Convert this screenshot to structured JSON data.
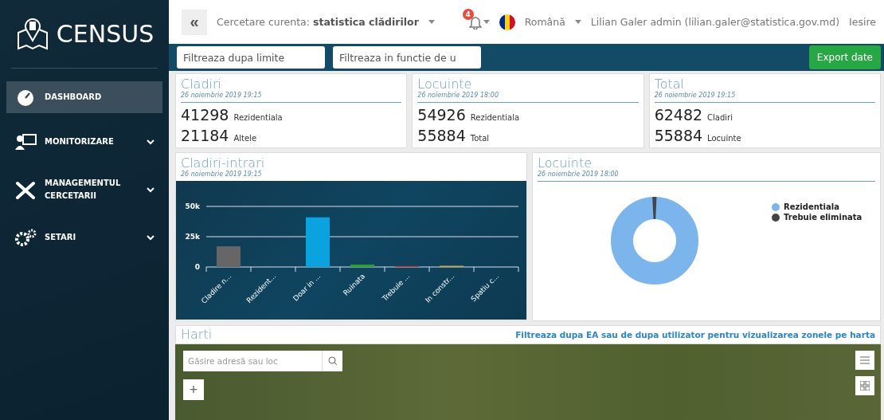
{
  "brand": {
    "name": "CENSUS"
  },
  "sidebar": {
    "items": [
      {
        "label": "DASHBOARD",
        "kind": "dashboard",
        "selected": true,
        "expandable": false
      },
      {
        "label": "MONITORIZARE",
        "kind": "monitor",
        "selected": false,
        "expandable": true
      },
      {
        "label": "MANAGEMENTUL CERCETARII",
        "kind": "tools",
        "selected": false,
        "expandable": true
      },
      {
        "label": "SETARI",
        "kind": "gears",
        "selected": false,
        "expandable": true
      }
    ]
  },
  "topbar": {
    "collapse": "«",
    "research_label": "Cercetare curenta:",
    "research_value": "statistica clădirilor",
    "notifications": "4",
    "language": "Română",
    "user": "Lilian Galer admin (lilian.galer@statistica.gov.md)",
    "logout": "Iesire"
  },
  "filters": {
    "fields": [
      {
        "placeholder": "Filtreaza dupa limite"
      },
      {
        "placeholder": "Filtreaza in functie de u"
      }
    ],
    "export": "Export date"
  },
  "summary_cards": [
    {
      "title": "Cladiri",
      "date": "26 noiembrie 2019 19:15",
      "rows": [
        {
          "value": "41298",
          "label": "Rezidentiala"
        },
        {
          "value": "21184",
          "label": "Altele"
        }
      ]
    },
    {
      "title": "Locuinte",
      "date": "26 noiembrie 2019 18:00",
      "rows": [
        {
          "value": "54926",
          "label": "Rezidentiala"
        },
        {
          "value": "55884",
          "label": "Total"
        }
      ]
    },
    {
      "title": "Total",
      "date": "26 noiembrie 2019 19:15",
      "rows": [
        {
          "value": "62482",
          "label": "Cladiri"
        },
        {
          "value": "55884",
          "label": "Locuinte"
        }
      ]
    }
  ],
  "bar_panel": {
    "title": "Cladiri-intrari",
    "date": "26 noiembrie 2019 19:15",
    "chart_data": {
      "type": "bar",
      "categories": [
        "Cladire n...",
        "Rezident...",
        "Doar in ...",
        "Ruinata",
        "Trebuie ...",
        "In constr...",
        "Spatiu c..."
      ],
      "ylim": [
        0,
        50000
      ],
      "series": [
        {
          "color": "#666666",
          "values": [
            17000,
            null,
            null,
            null,
            null,
            null,
            null
          ]
        },
        {
          "color": "#0aa3e0",
          "values": [
            null,
            null,
            41000,
            null,
            null,
            null,
            null
          ]
        },
        {
          "color": "#2ca02c",
          "values": [
            null,
            null,
            null,
            2000,
            null,
            null,
            null
          ]
        },
        {
          "color": "#d62728",
          "values": [
            null,
            null,
            null,
            null,
            800,
            null,
            null
          ]
        },
        {
          "color": "#c8a838",
          "values": [
            null,
            null,
            null,
            null,
            null,
            1000,
            null
          ]
        }
      ],
      "yticks": [
        {
          "value": 0,
          "label": "0"
        },
        {
          "value": 25000,
          "label": "25k"
        },
        {
          "value": 50000,
          "label": "50k"
        }
      ]
    }
  },
  "donut_panel": {
    "title": "Locuinte",
    "date": "26 noiembrie 2019 18:00",
    "legend": [
      {
        "label": "Rezidentiala",
        "color": "#7cb5ec"
      },
      {
        "label": "Trebuie eliminata",
        "color": "#434348"
      }
    ]
  },
  "map_panel": {
    "title": "Harti",
    "hint": "Filtreaza dupa EA sau de dupa utilizator pentru vizualizarea zonele pe harta",
    "search_placeholder": "Găsire adresă sau loc",
    "zoom_in": "+"
  }
}
